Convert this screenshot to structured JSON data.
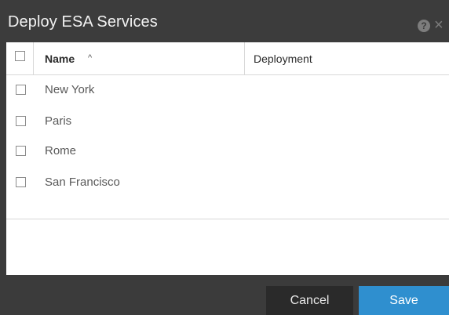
{
  "dialog": {
    "title": "Deploy ESA Services",
    "help_glyph": "?",
    "close_glyph": "×"
  },
  "table": {
    "columns": {
      "name": "Name",
      "sort_glyph": "^",
      "deployment": "Deployment"
    },
    "rows": [
      {
        "name": "New York",
        "deployment": ""
      },
      {
        "name": "Paris",
        "deployment": ""
      },
      {
        "name": "Rome",
        "deployment": ""
      },
      {
        "name": "San Francisco",
        "deployment": ""
      }
    ]
  },
  "footer": {
    "cancel_label": "Cancel",
    "save_label": "Save"
  },
  "colors": {
    "titlebar_bg": "#3c3c3c",
    "save_button_bg": "#2f8fcf",
    "cancel_button_bg": "#2a2a2a"
  }
}
